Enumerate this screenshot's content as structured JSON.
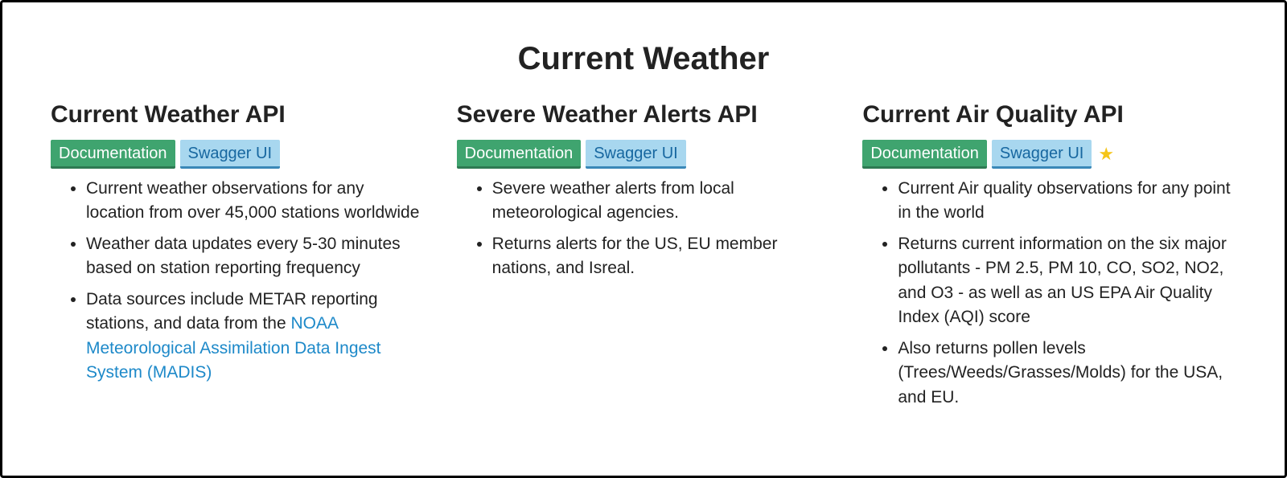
{
  "page_title": "Current Weather",
  "buttons": {
    "documentation": "Documentation",
    "swagger": "Swagger UI"
  },
  "cols": [
    {
      "title": "Current Weather API",
      "starred": false,
      "items": [
        {
          "text": "Current weather observations for any location from over 45,000 stations worldwide"
        },
        {
          "text": "Weather data updates every 5-30 minutes based on station reporting frequency"
        },
        {
          "text_prefix": "Data sources include METAR reporting stations, and data from the ",
          "link_text": "NOAA Meteorological Assimilation Data Ingest System (MADIS)",
          "text_suffix": ""
        }
      ]
    },
    {
      "title": "Severe Weather Alerts API",
      "starred": false,
      "items": [
        {
          "text": "Severe weather alerts from local meteorological agencies."
        },
        {
          "text": "Returns alerts for the US, EU member nations, and Isreal."
        }
      ]
    },
    {
      "title": "Current Air Quality API",
      "starred": true,
      "items": [
        {
          "text": "Current Air quality observations for any point in the world"
        },
        {
          "text": "Returns current information on the six major pollutants - PM 2.5, PM 10, CO, SO2, NO2, and O3 - as well as an US EPA Air Quality Index (AQI) score"
        },
        {
          "text": "Also returns pollen levels (Trees/Weeds/Grasses/Molds) for the USA, and EU."
        }
      ]
    }
  ]
}
